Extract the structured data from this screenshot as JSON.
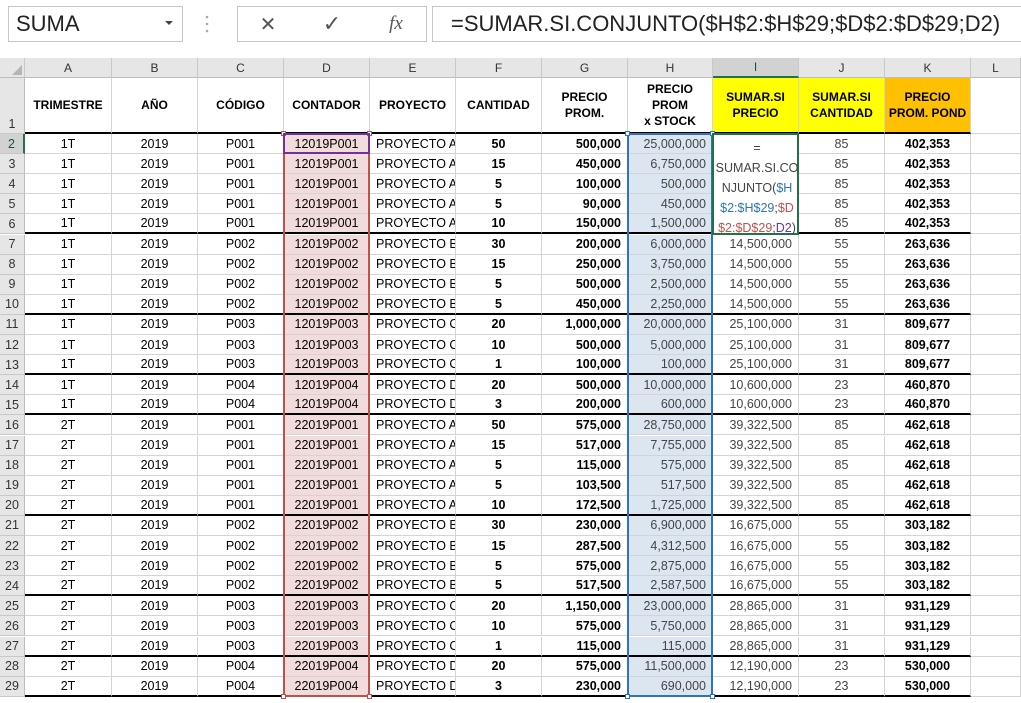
{
  "name_box": {
    "value": "SUMA"
  },
  "formula_bar": {
    "cancel_label": "✕",
    "enter_label": "✓",
    "fx_label": "fx",
    "formula": "=SUMAR.SI.CONJUNTO($H$2:$H$29;$D$2:$D$29;D2)"
  },
  "active_cell": "I2",
  "columns": [
    "A",
    "B",
    "C",
    "D",
    "E",
    "F",
    "G",
    "H",
    "I",
    "J",
    "K",
    "L"
  ],
  "headers": [
    "TRIMESTRE",
    "AÑO",
    "CÓDIGO",
    "CONTADOR",
    "PROYECTO",
    "CANTIDAD",
    "PRECIO\nPROM.",
    "PRECIO PROM\nx STOCK",
    "SUMAR.SI\nPRECIO",
    "SUMAR.SI\nCANTIDAD",
    "PRECIO\nPROM. POND"
  ],
  "header_colors": {
    "yellow": "#ffff00",
    "orange": "#ffc000"
  },
  "range_colors": {
    "counter_range": "#c0504d",
    "stock_range": "#2e75b6",
    "counter_fill": "#f2dcdb",
    "stock_fill": "#dce6f1"
  },
  "edit_formula_parts": [
    {
      "text": "=\nSUMAR.SI.CONJUNTO(",
      "color": "#444444"
    },
    {
      "text": "$H$2:$H$29",
      "color": "#2e75b6"
    },
    {
      "text": ";",
      "color": "#444444"
    },
    {
      "text": "$D$2:$D$29",
      "color": "#c0504d"
    },
    {
      "text": ";",
      "color": "#444444"
    },
    {
      "text": "D2",
      "color": "#7030a0"
    },
    {
      "text": ")",
      "color": "#444444"
    }
  ],
  "rows": [
    [
      "1T",
      "2019",
      "P001",
      "12019P001",
      "PROYECTO A",
      "50",
      "500,000",
      "25,000,000",
      "",
      "85",
      "402,353"
    ],
    [
      "1T",
      "2019",
      "P001",
      "12019P001",
      "PROYECTO A",
      "15",
      "450,000",
      "6,750,000",
      "",
      "85",
      "402,353"
    ],
    [
      "1T",
      "2019",
      "P001",
      "12019P001",
      "PROYECTO A",
      "5",
      "100,000",
      "500,000",
      "",
      "85",
      "402,353"
    ],
    [
      "1T",
      "2019",
      "P001",
      "12019P001",
      "PROYECTO A",
      "5",
      "90,000",
      "450,000",
      "",
      "85",
      "402,353"
    ],
    [
      "1T",
      "2019",
      "P001",
      "12019P001",
      "PROYECTO A",
      "10",
      "150,000",
      "1,500,000",
      "",
      "85",
      "402,353"
    ],
    [
      "1T",
      "2019",
      "P002",
      "12019P002",
      "PROYECTO B",
      "30",
      "200,000",
      "6,000,000",
      "14,500,000",
      "55",
      "263,636"
    ],
    [
      "1T",
      "2019",
      "P002",
      "12019P002",
      "PROYECTO B",
      "15",
      "250,000",
      "3,750,000",
      "14,500,000",
      "55",
      "263,636"
    ],
    [
      "1T",
      "2019",
      "P002",
      "12019P002",
      "PROYECTO B",
      "5",
      "500,000",
      "2,500,000",
      "14,500,000",
      "55",
      "263,636"
    ],
    [
      "1T",
      "2019",
      "P002",
      "12019P002",
      "PROYECTO B",
      "5",
      "450,000",
      "2,250,000",
      "14,500,000",
      "55",
      "263,636"
    ],
    [
      "1T",
      "2019",
      "P003",
      "12019P003",
      "PROYECTO C",
      "20",
      "1,000,000",
      "20,000,000",
      "25,100,000",
      "31",
      "809,677"
    ],
    [
      "1T",
      "2019",
      "P003",
      "12019P003",
      "PROYECTO C",
      "10",
      "500,000",
      "5,000,000",
      "25,100,000",
      "31",
      "809,677"
    ],
    [
      "1T",
      "2019",
      "P003",
      "12019P003",
      "PROYECTO C",
      "1",
      "100,000",
      "100,000",
      "25,100,000",
      "31",
      "809,677"
    ],
    [
      "1T",
      "2019",
      "P004",
      "12019P004",
      "PROYECTO D",
      "20",
      "500,000",
      "10,000,000",
      "10,600,000",
      "23",
      "460,870"
    ],
    [
      "1T",
      "2019",
      "P004",
      "12019P004",
      "PROYECTO D",
      "3",
      "200,000",
      "600,000",
      "10,600,000",
      "23",
      "460,870"
    ],
    [
      "2T",
      "2019",
      "P001",
      "22019P001",
      "PROYECTO A",
      "50",
      "575,000",
      "28,750,000",
      "39,322,500",
      "85",
      "462,618"
    ],
    [
      "2T",
      "2019",
      "P001",
      "22019P001",
      "PROYECTO A",
      "15",
      "517,000",
      "7,755,000",
      "39,322,500",
      "85",
      "462,618"
    ],
    [
      "2T",
      "2019",
      "P001",
      "22019P001",
      "PROYECTO A",
      "5",
      "115,000",
      "575,000",
      "39,322,500",
      "85",
      "462,618"
    ],
    [
      "2T",
      "2019",
      "P001",
      "22019P001",
      "PROYECTO A",
      "5",
      "103,500",
      "517,500",
      "39,322,500",
      "85",
      "462,618"
    ],
    [
      "2T",
      "2019",
      "P001",
      "22019P001",
      "PROYECTO A",
      "10",
      "172,500",
      "1,725,000",
      "39,322,500",
      "85",
      "462,618"
    ],
    [
      "2T",
      "2019",
      "P002",
      "22019P002",
      "PROYECTO B",
      "30",
      "230,000",
      "6,900,000",
      "16,675,000",
      "55",
      "303,182"
    ],
    [
      "2T",
      "2019",
      "P002",
      "22019P002",
      "PROYECTO B",
      "15",
      "287,500",
      "4,312,500",
      "16,675,000",
      "55",
      "303,182"
    ],
    [
      "2T",
      "2019",
      "P002",
      "22019P002",
      "PROYECTO B",
      "5",
      "575,000",
      "2,875,000",
      "16,675,000",
      "55",
      "303,182"
    ],
    [
      "2T",
      "2019",
      "P002",
      "22019P002",
      "PROYECTO B",
      "5",
      "517,500",
      "2,587,500",
      "16,675,000",
      "55",
      "303,182"
    ],
    [
      "2T",
      "2019",
      "P003",
      "22019P003",
      "PROYECTO C",
      "20",
      "1,150,000",
      "23,000,000",
      "28,865,000",
      "31",
      "931,129"
    ],
    [
      "2T",
      "2019",
      "P003",
      "22019P003",
      "PROYECTO C",
      "10",
      "575,000",
      "5,750,000",
      "28,865,000",
      "31",
      "931,129"
    ],
    [
      "2T",
      "2019",
      "P003",
      "22019P003",
      "PROYECTO C",
      "1",
      "115,000",
      "115,000",
      "28,865,000",
      "31",
      "931,129"
    ],
    [
      "2T",
      "2019",
      "P004",
      "22019P004",
      "PROYECTO D",
      "20",
      "575,000",
      "11,500,000",
      "12,190,000",
      "23",
      "530,000"
    ],
    [
      "2T",
      "2019",
      "P004",
      "22019P004",
      "PROYECTO D",
      "3",
      "230,000",
      "690,000",
      "12,190,000",
      "23",
      "530,000"
    ]
  ],
  "row_numbers": [
    "1",
    "2",
    "3",
    "4",
    "5",
    "6",
    "7",
    "8",
    "9",
    "10",
    "11",
    "12",
    "13",
    "14",
    "15",
    "16",
    "17",
    "18",
    "19",
    "20",
    "21",
    "22",
    "23",
    "24",
    "25",
    "26",
    "27",
    "28",
    "29"
  ]
}
